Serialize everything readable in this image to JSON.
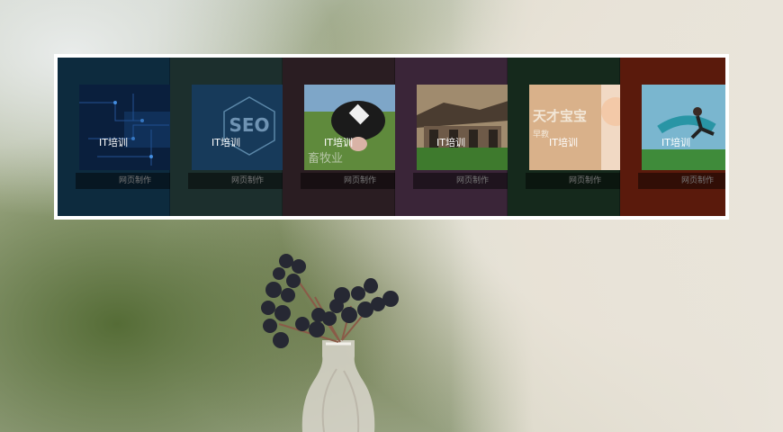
{
  "slider": {
    "frame_color": "#ffffff",
    "slides": [
      {
        "caption": "IT培训",
        "tag": "网页制作",
        "color": "#0d2b3e",
        "thumb_icon": "circuit-board-image"
      },
      {
        "caption": "IT培训",
        "tag": "网页制作",
        "color": "#1c2f2d",
        "thumb_icon": "seo-hexagon-image",
        "thumb_text": "SEO"
      },
      {
        "caption": "IT培训",
        "tag": "网页制作",
        "color": "#2a1d22",
        "thumb_icon": "cow-image",
        "thumb_text": "畜牧业"
      },
      {
        "caption": "IT培训",
        "tag": "网页制作",
        "color": "#3a2538",
        "thumb_icon": "temple-image"
      },
      {
        "caption": "IT培训",
        "tag": "网页制作",
        "color": "#15291c",
        "thumb_icon": "child-banner-image",
        "thumb_text": "天才宝宝",
        "thumb_subtext": "早教"
      },
      {
        "caption": "IT培训",
        "tag": "网页制作",
        "color": "#5a1a0c",
        "thumb_icon": "jumping-man-image"
      }
    ]
  }
}
